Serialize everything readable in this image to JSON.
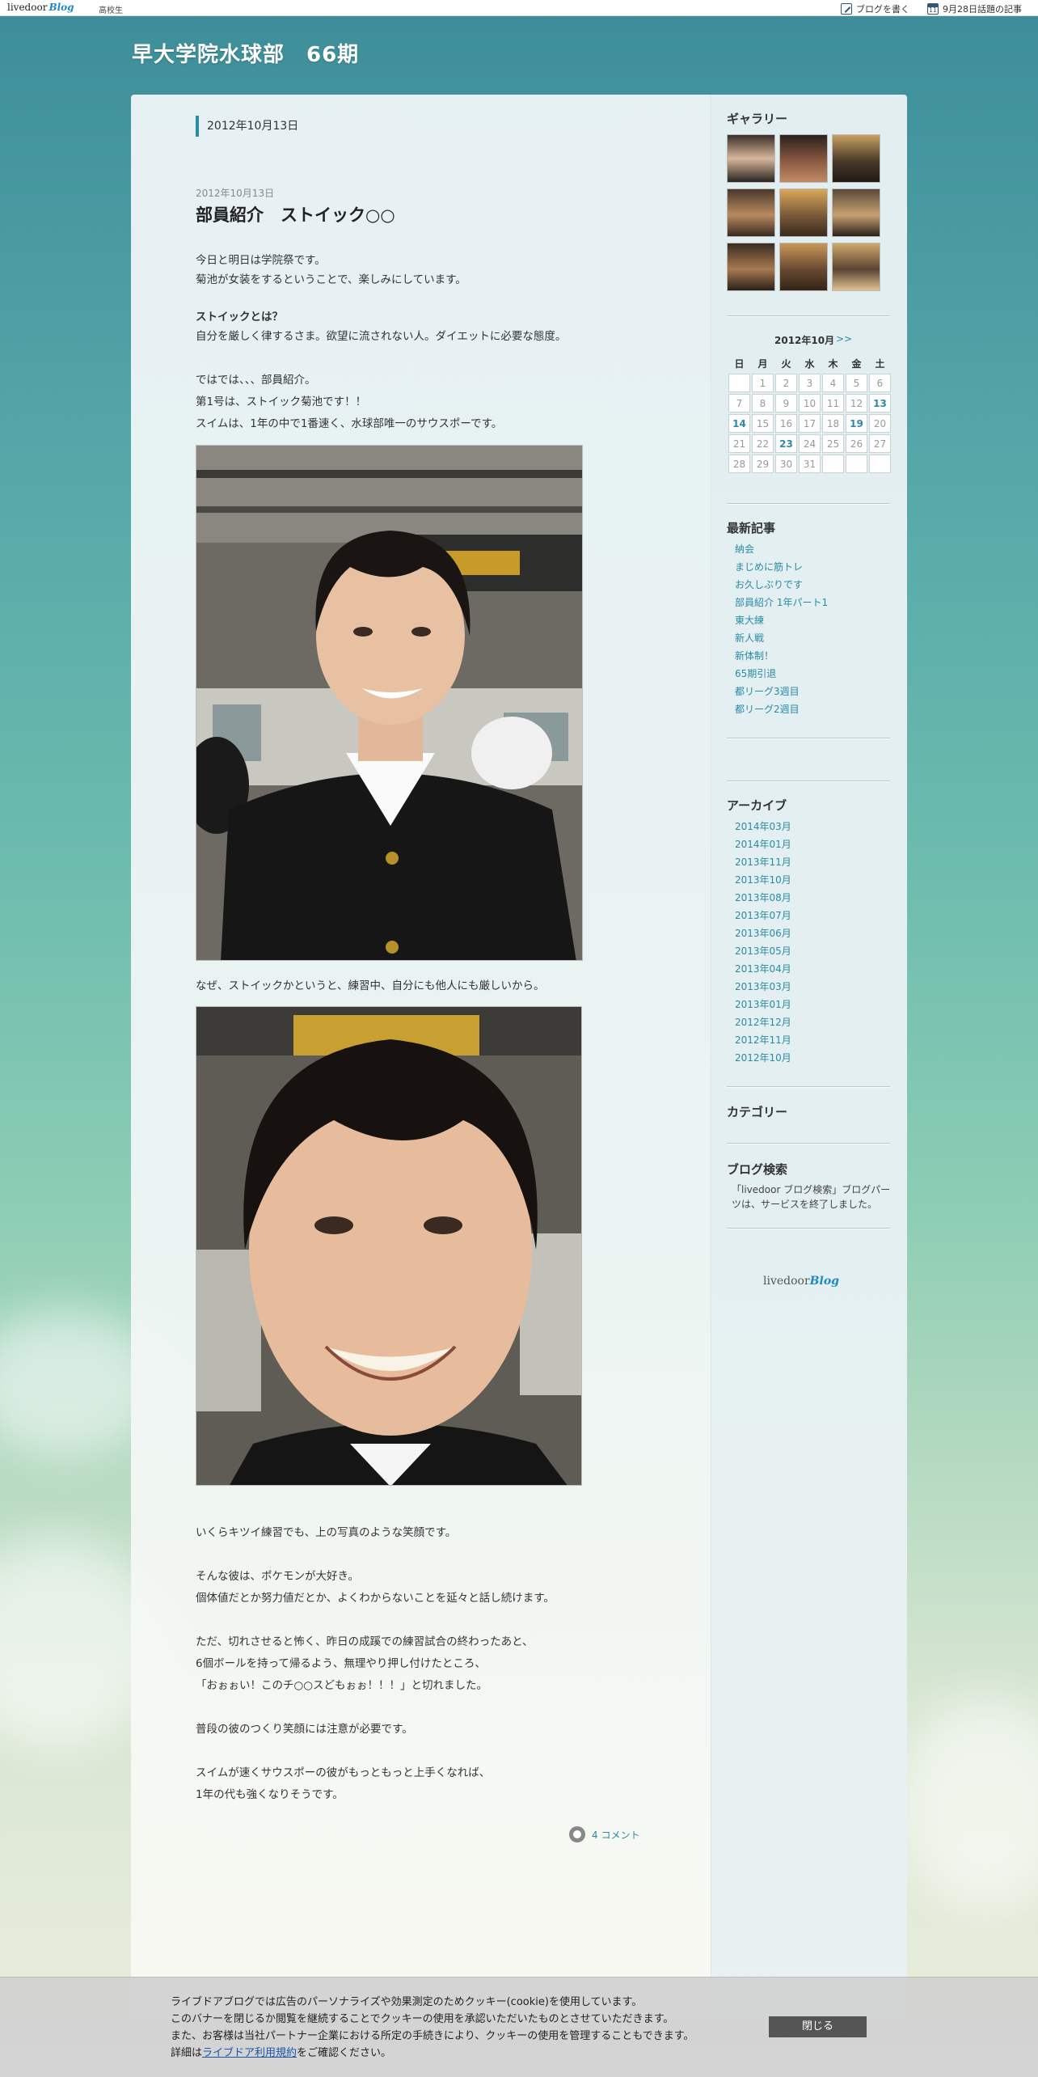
{
  "topbar": {
    "logo": "livedoor",
    "logo_suffix": "Blog",
    "category": "高校生",
    "write_link": "ブログを書く",
    "trending_link": "9月28日話題の記事"
  },
  "blog": {
    "title": "早大学院水球部　66期"
  },
  "post": {
    "date_header": "2012年10月13日",
    "date": "2012年10月13日",
    "title": "部員紹介　ストイック○○",
    "lines": [
      "今日と明日は学院祭です。",
      "菊池が女装をするということで、楽しみにしています。",
      "ストイックとは？",
      " 自分を厳しく律するさま。欲望に流されない人。ダイエットに必要な態度。",
      "ではでは、、、部員紹介。",
      "第1号は、ストイック菊池です！！",
      "スイムは、1年の中で1番速く、水球部唯一のサウスポーです。",
      "なぜ、ストイックかというと、練習中、自分にも他人にも厳しいから。",
      "いくらキツイ練習でも、上の写真のような笑顔です。",
      "そんな彼は、ポケモンが大好き。",
      "個体値だとか努力値だとか、よくわからないことを延々と話し続けます。",
      "ただ、切れさせると怖く、昨日の成蹊での練習試合の終わったあと、",
      "6個ボールを持って帰るよう、無理やり押し付けたところ、",
      "「おぉぉい！このチ○○スどもぉぉ！！！」と切れました。",
      "普段の彼のつくり笑顔には注意が必要です。",
      " スイムが速くサウスポーの彼がもっともっと上手くなれば、",
      "1年の代も強くなりそうです。"
    ],
    "comments": "4 コメント"
  },
  "sidebar": {
    "gallery_title": "ギャラリー",
    "calendar": {
      "title": "2012年10月",
      "next": ">>",
      "weekdays": [
        "日",
        "月",
        "火",
        "水",
        "木",
        "金",
        "土"
      ],
      "weeks": [
        [
          "",
          "1",
          "2",
          "3",
          "4",
          "5",
          "6"
        ],
        [
          "7",
          "8",
          "9",
          "10",
          "11",
          "12",
          "13"
        ],
        [
          "14",
          "15",
          "16",
          "17",
          "18",
          "19",
          "20"
        ],
        [
          "21",
          "22",
          "23",
          "24",
          "25",
          "26",
          "27"
        ],
        [
          "28",
          "29",
          "30",
          "31",
          "",
          "",
          ""
        ]
      ],
      "linked_days": [
        "13",
        "14",
        "19",
        "23"
      ]
    },
    "recent_title": "最新記事",
    "recent": [
      "納会",
      "まじめに筋トレ",
      "お久しぶりです",
      "部員紹介 1年パート1",
      "東大練",
      "新人戦",
      "新体制！",
      "65期引退",
      "都リーグ3週目",
      "都リーグ2週目"
    ],
    "archive_title": "アーカイブ",
    "archives": [
      "2014年03月",
      "2014年01月",
      "2013年11月",
      "2013年10月",
      "2013年08月",
      "2013年07月",
      "2013年06月",
      "2013年05月",
      "2013年04月",
      "2013年03月",
      "2013年01月",
      "2012年12月",
      "2012年11月",
      "2012年10月"
    ],
    "category_title": "カテゴリー",
    "search_title": "ブログ検索",
    "search_note": "「livedoor ブログ検索」ブログパーツは、サービスを終了しました。",
    "footer_logo": "livedoor",
    "footer_logo_suffix": "Blog"
  },
  "cookie": {
    "line1": "ライブドアブログでは広告のパーソナライズや効果測定のためクッキー(cookie)を使用しています。",
    "line2": "このバナーを閉じるか閲覧を継続することでクッキーの使用を承認いただいたものとさせていただきます。",
    "line3": "また、お客様は当社パートナー企業における所定の手続きにより、クッキーの使用を管理することもできます。",
    "line4_prefix": "詳細は",
    "line4_link": "ライブドア利用規約",
    "line4_suffix": "をご確認ください。",
    "close": "閉じる"
  }
}
